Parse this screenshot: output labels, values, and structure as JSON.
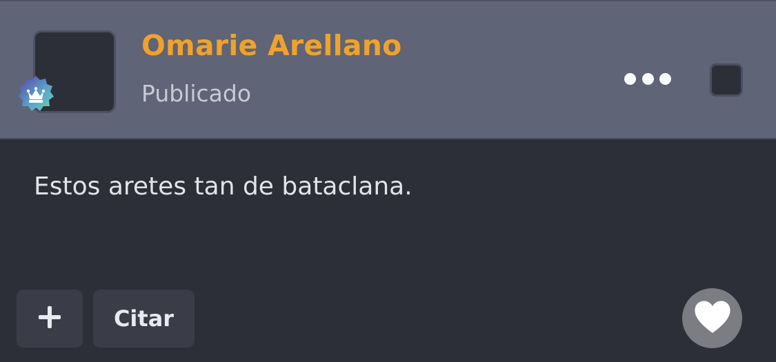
{
  "post": {
    "author_name": "Omarie Arellano",
    "status": "Publicado",
    "text": "Estos aretes tan de bataclana."
  },
  "actions": {
    "add_icon": "plus-icon",
    "quote_label": "Citar",
    "like_icon": "heart-icon",
    "more_icon": "more-horizontal-icon"
  },
  "badge": {
    "icon": "crown-icon",
    "colors": [
      "#5b3fa8",
      "#6fd3b8"
    ]
  },
  "colors": {
    "header_bg": "#5f6477",
    "body_bg": "#2d2f38",
    "author_name": "#f0a22a",
    "button_bg": "#3a3d48",
    "like_bg": "#7b7d82"
  }
}
